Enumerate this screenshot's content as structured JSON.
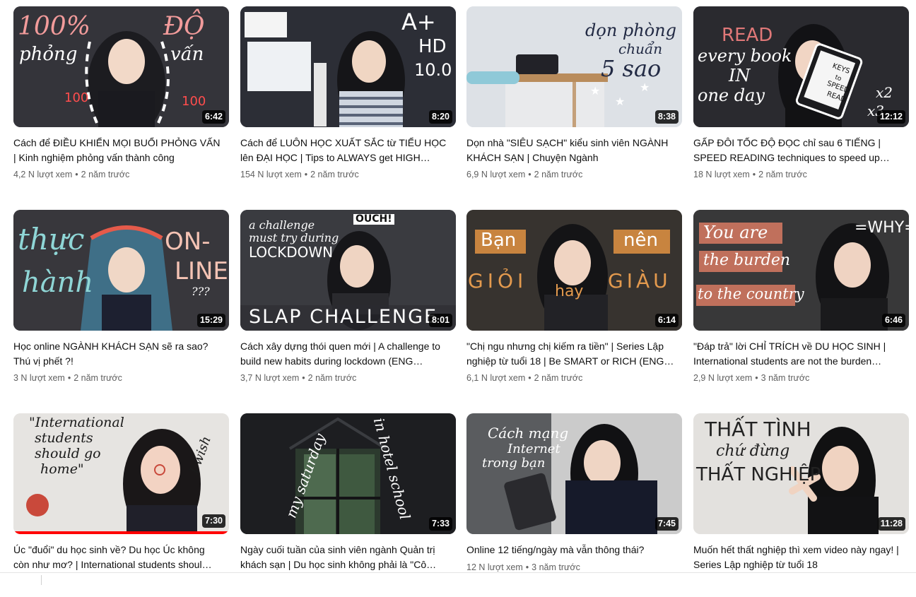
{
  "videos": [
    {
      "title": "Cách để ĐIỀU KHIỂN MỌI BUỔI PHỎNG VẤN | Kinh nghiệm phỏng vấn thành công",
      "views": "4,2 N lượt xem",
      "age": "2 năm trước",
      "duration": "6:42",
      "overlay": [
        "100%",
        "phỏng",
        "ĐỘ",
        "vấn"
      ],
      "bg": "#3a3a40"
    },
    {
      "title": "Cách để LUÔN HỌC XUẤT SẮC từ TIỂU HỌC lên ĐẠI HỌC | Tips to ALWAYS get HIGH…",
      "views": "154 N lượt xem",
      "age": "2 năm trước",
      "duration": "8:20",
      "overlay": [
        "A+",
        "HD",
        "10.0"
      ],
      "bg": "#2d2f38"
    },
    {
      "title": "Dọn nhà \"SIÊU SẠCH\" kiểu sinh viên NGÀNH KHÁCH SẠN | Chuyện Ngành",
      "views": "6,9 N lượt xem",
      "age": "2 năm trước",
      "duration": "8:38",
      "overlay": [
        "dọn phòng",
        "chuẩn",
        "5 sao"
      ],
      "bg": "#d9dde2"
    },
    {
      "title": "GẤP ĐÔI TỐC ĐỘ ĐỌC chỉ sau 6 TIẾNG | SPEED READING techniques to speed up…",
      "views": "18 N lượt xem",
      "age": "2 năm trước",
      "duration": "12:12",
      "overlay": [
        "READ",
        "every book",
        "IN",
        "one day",
        "KEYS",
        "to",
        "SPEED",
        "READ",
        "x2",
        "x3"
      ],
      "bg": "#2b2b30"
    },
    {
      "title": "Học online NGÀNH KHÁCH SẠN sẽ ra sao? Thú vị phết ?!",
      "views": "3 N lượt xem",
      "age": "2 năm trước",
      "duration": "15:29",
      "overlay": [
        "thực",
        "hành",
        "ON-",
        "LINE",
        "???"
      ],
      "bg": "#3b3a3f"
    },
    {
      "title": "Cách xây dựng thói quen mới | A challenge to build new habits during lockdown (ENG…",
      "views": "3,7 N lượt xem",
      "age": "2 năm trước",
      "duration": "8:01",
      "overlay": [
        "a challenge",
        "must try during",
        "LOCKDOWN",
        "OUCH!",
        "SLAP CHALLENGE"
      ],
      "bg": "#3c3d42"
    },
    {
      "title": "\"Chị ngu nhưng chị kiếm ra tiền\" | Series Lập nghiệp từ tuổi 18 | Be SMART or RICH (ENG…",
      "views": "6,1 N lượt xem",
      "age": "2 năm trước",
      "duration": "6:14",
      "overlay": [
        "Bạn",
        "nên",
        "GIỎI",
        "hay",
        "GIÀU"
      ],
      "bg": "#3a3634"
    },
    {
      "title": "\"Đáp trả\" lời CHỈ TRÍCH về DU HỌC SINH | International students are not the burden…",
      "views": "2,9 N lượt xem",
      "age": "3 năm trước",
      "duration": "6:46",
      "overlay": [
        "You are",
        "the burden",
        "to the country",
        "=WHY="
      ],
      "bg": "#3a3a3c"
    },
    {
      "title": "Úc \"đuổi\" du học sinh về? Du học Úc không còn như mơ? | International students shoul…",
      "views": "",
      "age": "",
      "duration": "7:30",
      "overlay": [
        "\"International",
        "students",
        "should go",
        "home\"",
        "I wish"
      ],
      "bg": "#e8e6e3",
      "progress": 1.0
    },
    {
      "title": "Ngày cuối tuần của sinh viên ngành Quản trị khách sạn | Du học sinh không phải là \"Cô…",
      "views": "",
      "age": "",
      "duration": "7:33",
      "overlay": [
        "my saturday",
        "in hotel school"
      ],
      "bg": "#1e1f22"
    },
    {
      "title": "Online 12 tiếng/ngày mà vẫn thông thái?",
      "views": "12 N lượt xem",
      "age": "3 năm trước",
      "duration": "7:45",
      "overlay": [
        "Cách mạng",
        "Internet",
        "trong bạn"
      ],
      "bg": "#cfcfcf"
    },
    {
      "title": "Muốn hết thất nghiệp thì xem video này ngay! | Series Lập nghiệp từ tuổi 18",
      "views": "",
      "age": "",
      "duration": "11:28",
      "overlay": [
        "THẤT TÌNH",
        "chứ đừng",
        "THẤT NGHIỆP"
      ],
      "bg": "#e4e2df"
    }
  ],
  "colors": {
    "title": "#0f0f0f",
    "meta": "#606060",
    "progress": "#ff0000"
  }
}
